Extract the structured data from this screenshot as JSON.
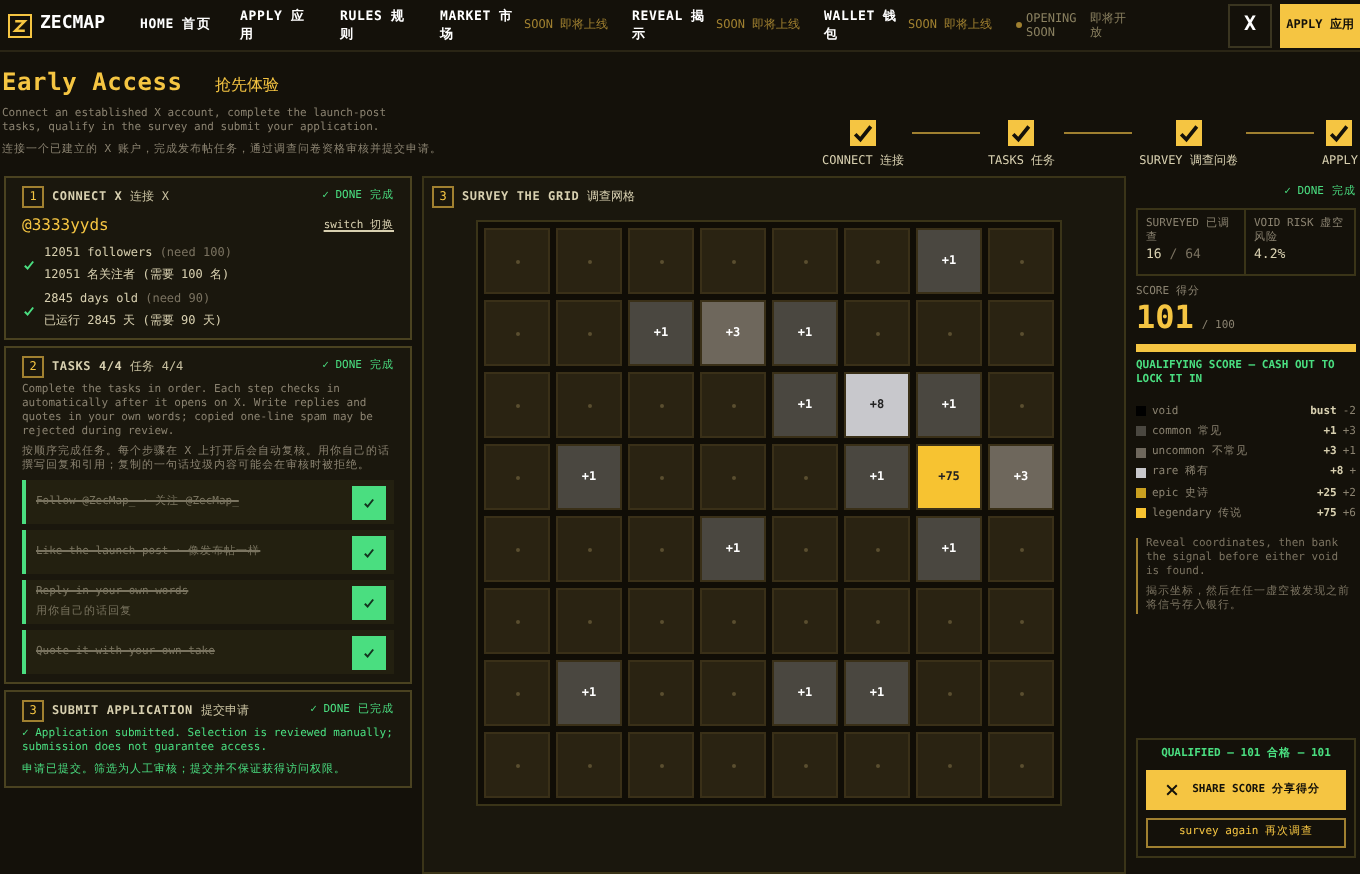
{
  "nav": {
    "logo": "ZECMAP",
    "items": [
      {
        "label": "HOME",
        "zh": "首页"
      },
      {
        "label": "APPLY",
        "zh": "应用"
      },
      {
        "label": "RULES",
        "zh": "规则"
      },
      {
        "label": "MARKET",
        "zh": "市场",
        "soon": "SOON 即将上线"
      },
      {
        "label": "REVEAL",
        "zh": "揭示",
        "soon": "SOON 即将上线"
      },
      {
        "label": "WALLET",
        "zh": "钱包",
        "soon": "SOON 即将上线"
      }
    ],
    "status": "OPENING SOON",
    "status_zh": "即将开放",
    "x_button": "X",
    "apply_button": "APPLY",
    "apply_button_zh": "应用"
  },
  "hero": {
    "title": "Early Access",
    "title_zh": "抢先体验",
    "subtitle": "Connect an established X account, complete the launch-post tasks, qualify in the survey and submit your application.",
    "subtitle_zh": "连接一个已建立的 X 账户，完成发布帖任务，通过调查问卷资格审核并提交申请。"
  },
  "steps": [
    {
      "label": "CONNECT",
      "zh": "连接",
      "done": true
    },
    {
      "label": "TASKS",
      "zh": "任务",
      "done": true
    },
    {
      "label": "SURVEY",
      "zh": "调查问卷",
      "done": true
    },
    {
      "label": "APPLY",
      "done": true
    }
  ],
  "connect": {
    "number": "1",
    "title": "CONNECT X",
    "title_zh": "连接 X",
    "status": "✓ DONE",
    "status_zh": "完成",
    "handle": "@3333yyds",
    "switch": "switch 切换",
    "checks": [
      {
        "en": "12051 followers",
        "need": "(need 100)",
        "zh": "12051 名关注者 (需要 100 名)",
        "ok": true
      },
      {
        "en": "2845 days old",
        "need": "(need 90)",
        "zh": "已运行 2845 天 (需要 90 天)",
        "ok": true
      }
    ]
  },
  "tasks": {
    "number": "2",
    "title": "TASKS 4/4",
    "title_zh": "任务 4/4",
    "status": "✓ DONE",
    "status_zh": "完成",
    "intro": "Complete the tasks in order. Each step checks in automatically after it opens on X. Write replies and quotes in your own words; copied one-line spam may be rejected during review.",
    "intro_zh": "按顺序完成任务。每个步骤在 X 上打开后会自动复核。用你自己的话撰写回复和引用；复制的一句话垃圾内容可能会在审核时被拒绝。",
    "items": [
      {
        "title": "Follow @ZecMap_ · 关注 @ZecMap_",
        "done": true
      },
      {
        "title": "Like the launch post · 像发布帖一样",
        "done": true
      },
      {
        "title": "Reply in your own words",
        "zh": "用你自己的话回复",
        "done": true
      },
      {
        "title": "Quote it with your own take",
        "done": true
      }
    ]
  },
  "submit": {
    "number": "3",
    "title": "SUBMIT APPLICATION",
    "title_zh": "提交申请",
    "status": "✓ DONE",
    "status_zh": "已完成",
    "message": "✓ Application submitted. Selection is reviewed manually; submission does not guarantee access.",
    "message_zh": "申请已提交。筛选为人工审核；提交并不保证获得访问权限。"
  },
  "survey": {
    "number": "3",
    "title": "SURVEY THE GRID",
    "title_zh": "调查网格",
    "status": "✓ DONE",
    "status_zh": "完成",
    "grid": [
      [
        {
          "kind": "hidden"
        },
        {
          "kind": "hidden"
        },
        {
          "kind": "hidden"
        },
        {
          "kind": "hidden"
        },
        {
          "kind": "hidden"
        },
        {
          "kind": "hidden"
        },
        {
          "kind": "common",
          "value": "+1"
        },
        {
          "kind": "hidden"
        }
      ],
      [
        {
          "kind": "hidden"
        },
        {
          "kind": "hidden"
        },
        {
          "kind": "common",
          "value": "+1"
        },
        {
          "kind": "uncommon",
          "value": "+3"
        },
        {
          "kind": "common",
          "value": "+1"
        },
        {
          "kind": "hidden"
        },
        {
          "kind": "hidden"
        },
        {
          "kind": "hidden"
        }
      ],
      [
        {
          "kind": "hidden"
        },
        {
          "kind": "hidden"
        },
        {
          "kind": "hidden"
        },
        {
          "kind": "hidden"
        },
        {
          "kind": "common",
          "value": "+1"
        },
        {
          "kind": "rare",
          "value": "+8"
        },
        {
          "kind": "common",
          "value": "+1"
        },
        {
          "kind": "hidden"
        }
      ],
      [
        {
          "kind": "hidden"
        },
        {
          "kind": "common",
          "value": "+1"
        },
        {
          "kind": "hidden"
        },
        {
          "kind": "hidden"
        },
        {
          "kind": "hidden"
        },
        {
          "kind": "common",
          "value": "+1"
        },
        {
          "kind": "legendary",
          "value": "+75"
        },
        {
          "kind": "uncommon",
          "value": "+3"
        }
      ],
      [
        {
          "kind": "hidden"
        },
        {
          "kind": "hidden"
        },
        {
          "kind": "hidden"
        },
        {
          "kind": "common",
          "value": "+1"
        },
        {
          "kind": "hidden"
        },
        {
          "kind": "hidden"
        },
        {
          "kind": "common",
          "value": "+1"
        },
        {
          "kind": "hidden"
        }
      ],
      [
        {
          "kind": "hidden"
        },
        {
          "kind": "hidden"
        },
        {
          "kind": "hidden"
        },
        {
          "kind": "hidden"
        },
        {
          "kind": "hidden"
        },
        {
          "kind": "hidden"
        },
        {
          "kind": "hidden"
        },
        {
          "kind": "hidden"
        }
      ],
      [
        {
          "kind": "hidden"
        },
        {
          "kind": "common",
          "value": "+1"
        },
        {
          "kind": "hidden"
        },
        {
          "kind": "hidden"
        },
        {
          "kind": "common",
          "value": "+1"
        },
        {
          "kind": "common",
          "value": "+1"
        },
        {
          "kind": "hidden"
        },
        {
          "kind": "hidden"
        }
      ],
      [
        {
          "kind": "hidden"
        },
        {
          "kind": "hidden"
        },
        {
          "kind": "hidden"
        },
        {
          "kind": "hidden"
        },
        {
          "kind": "hidden"
        },
        {
          "kind": "hidden"
        },
        {
          "kind": "hidden"
        },
        {
          "kind": "hidden"
        }
      ]
    ]
  },
  "stats": {
    "surveyed_label": "SURVEYED 已调查",
    "surveyed": "16",
    "surveyed_total": "/ 64",
    "risk_label": "VOID RISK 虚空风险",
    "risk": "4.2%",
    "score_label": "SCORE 得分",
    "score": "101",
    "score_total": "/ 100",
    "level": 1,
    "qualify": "QUALIFYING SCORE — CASH OUT TO LOCK IT IN",
    "legend": [
      {
        "name": "void",
        "value": "bust",
        "extra": "-2",
        "color": "#000000"
      },
      {
        "name": "common",
        "zh": "常见",
        "value": "+1",
        "extra": "+3",
        "color": "#4a4740"
      },
      {
        "name": "uncommon",
        "zh": "不常见",
        "value": "+3",
        "extra": "+1",
        "color": "#6e675c"
      },
      {
        "name": "rare",
        "zh": "稀有",
        "value": "+8",
        "extra": "+",
        "color": "#c8c8cc"
      },
      {
        "name": "epic",
        "zh": "史诗",
        "value": "+25",
        "extra": "+2",
        "color": "#c9a020"
      },
      {
        "name": "legendary",
        "zh": "传说",
        "value": "+75",
        "extra": "+6",
        "color": "#f7c331"
      }
    ],
    "note": "Reveal coordinates, then bank the signal before either void is found.",
    "note_zh": "揭示坐标，然后在任一虚空被发现之前将信号存入银行。",
    "qualified": "QUALIFIED — 101 合格 — 101",
    "share": "SHARE SCORE",
    "share_zh": "分享得分",
    "again": "survey again 再次调查"
  }
}
